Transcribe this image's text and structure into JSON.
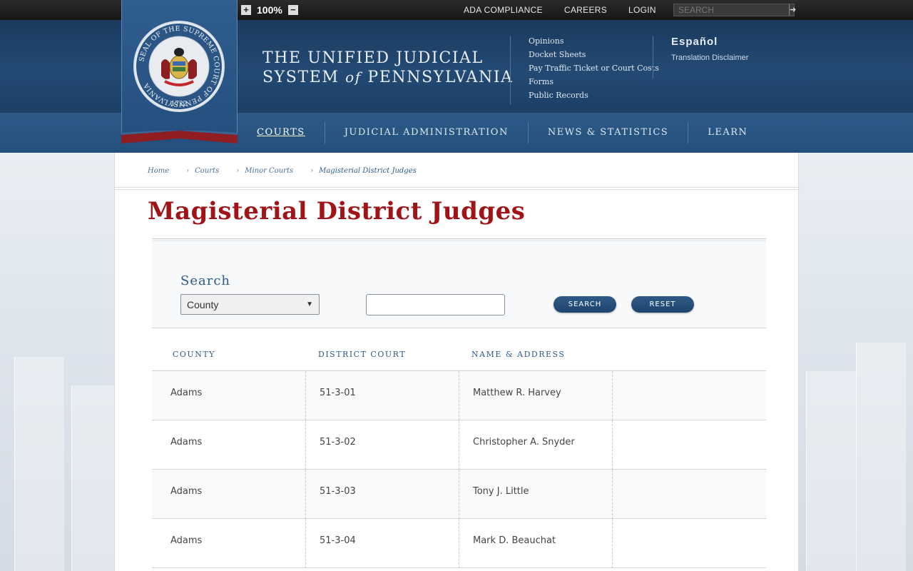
{
  "toolbar": {
    "zoom_in": "+",
    "zoom_value": "100%",
    "zoom_out": "−"
  },
  "top_links": [
    "ADA COMPLIANCE",
    "CAREERS",
    "LOGIN"
  ],
  "search": {
    "placeholder": "SEARCH",
    "go_icon": "arrow-right-icon"
  },
  "seal": {
    "text": "SEAL OF THE SUPREME COURT OF PENNSYLVANIA",
    "year": "1722"
  },
  "site_title": {
    "line1": "THE UNIFIED JUDICIAL",
    "line2_a": "SYSTEM",
    "line2_of": "of",
    "line2_b": "PENNSYLVANIA"
  },
  "quick_links": [
    "Opinions",
    "Docket Sheets",
    "Pay Traffic Ticket or Court Costs",
    "Forms",
    "Public Records"
  ],
  "language": {
    "espanol": "Español",
    "disclaimer": "Translation Disclaimer"
  },
  "nav": [
    "COURTS",
    "JUDICIAL ADMINISTRATION",
    "NEWS & STATISTICS",
    "LEARN"
  ],
  "breadcrumb": [
    "Home",
    "Courts",
    "Minor Courts",
    "Magisterial District Judges"
  ],
  "page_title": "Magisterial District Judges",
  "search_panel": {
    "label": "Search",
    "county_select": "County",
    "search_button": "SEARCH",
    "reset_button": "RESET"
  },
  "table": {
    "headers": [
      "COUNTY",
      "DISTRICT COURT",
      "NAME & ADDRESS"
    ],
    "rows": [
      {
        "county": "Adams",
        "district": "51-3-01",
        "name": "Matthew R. Harvey"
      },
      {
        "county": "Adams",
        "district": "51-3-02",
        "name": "Christopher A. Snyder"
      },
      {
        "county": "Adams",
        "district": "51-3-03",
        "name": "Tony J. Little"
      },
      {
        "county": "Adams",
        "district": "51-3-04",
        "name": "Mark D. Beauchat"
      }
    ]
  },
  "colors": {
    "title_red": "#a01418",
    "navy": "#1f446d",
    "link_blue": "#2e5a8a"
  }
}
